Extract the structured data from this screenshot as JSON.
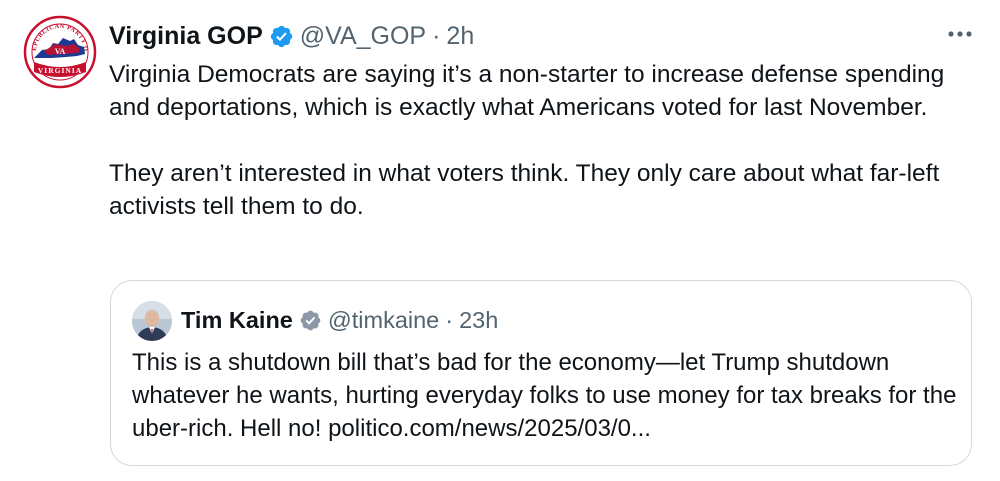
{
  "tweet": {
    "author": {
      "display_name": "Virginia GOP",
      "handle": "@VA_GOP",
      "separator": "·",
      "time": "2h",
      "verified_icon": "verified-badge-icon",
      "logo_text_top": "REPUBLICAN PARTY OF",
      "logo_text_bottom": "VIRGINIA",
      "logo_monogram": "VA"
    },
    "more_icon": "more-options-icon",
    "body": {
      "paragraph_1": "Virginia Democrats are saying it’s a non-starter to increase defense spending and deportations, which is exactly what Americans voted for last November.",
      "paragraph_2": "They aren’t interested in what voters think. They only care about what far-left activists tell them to do."
    },
    "quote": {
      "display_name": "Tim Kaine",
      "handle": "@timkaine",
      "separator": "·",
      "time": "23h",
      "verified_icon": "verified-badge-icon",
      "text": "This is a shutdown bill that’s bad for the economy—let Trump shutdown whatever he wants, hurting everyday folks to use money for tax breaks for the uber-rich. Hell no! politico.com/news/2025/03/0..."
    }
  },
  "colors": {
    "text_primary": "#0f1419",
    "text_secondary": "#536471",
    "verified_blue": "#1d9bf0",
    "border": "#cfd9de",
    "logo_red": "#c8102e",
    "logo_blue": "#1f3a93"
  }
}
